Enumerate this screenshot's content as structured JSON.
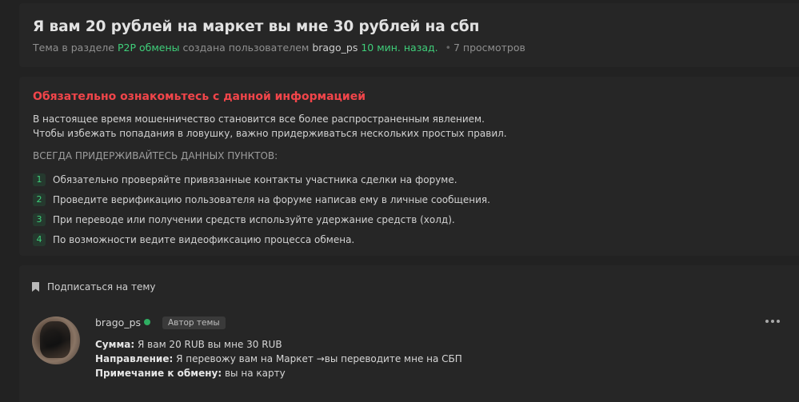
{
  "thread": {
    "title": "Я вам 20 рублей на маркет вы мне 30 рублей на сбп",
    "meta_prefix": "Тема в разделе",
    "section": "P2P обмены",
    "meta_created": "создана пользователем",
    "author": "brago_ps",
    "time": "10 мин. назад.",
    "views": "7 просмотров"
  },
  "warning": {
    "title": "Обязательно ознакомьтесь с данной информацией",
    "line1": "В настоящее время мошенничество становится все более распространенным явлением.",
    "line2": "Чтобы избежать попадания в ловушку, важно придерживаться нескольких простых правил.",
    "subheading": "ВСЕГДА ПРИДЕРЖИВАЙТЕСЬ ДАННЫХ ПУНКТОВ:",
    "rules": [
      {
        "num": "1",
        "text": "Обязательно проверяйте привязанные контакты участника сделки на форуме."
      },
      {
        "num": "2",
        "text": "Проведите верификацию пользователя на форуме написав ему в личные сообщения."
      },
      {
        "num": "3",
        "text": "При переводе или получении средств используйте удержание средств (холд)."
      },
      {
        "num": "4",
        "text": "По возможности ведите видеофиксацию процесса обмена."
      }
    ]
  },
  "subscribe": {
    "label": "Подписаться на тему",
    "icon": "bookmark-icon"
  },
  "post": {
    "username": "brago_ps",
    "badge": "Автор темы",
    "amount_label": "Сумма:",
    "amount_value": "Я вам 20 RUB вы мне 30 RUB",
    "direction_label": "Направление:",
    "direction_value": "Я перевожу вам на Маркет →вы переводите мне на СБП",
    "note_label": "Примечание к обмену:",
    "note_value": "вы на карту",
    "menu_icon": "more-icon"
  },
  "colors": {
    "accent_green": "#3fcf7a",
    "warning_red": "#f1454a",
    "background": "#222222",
    "panel": "#262626"
  }
}
